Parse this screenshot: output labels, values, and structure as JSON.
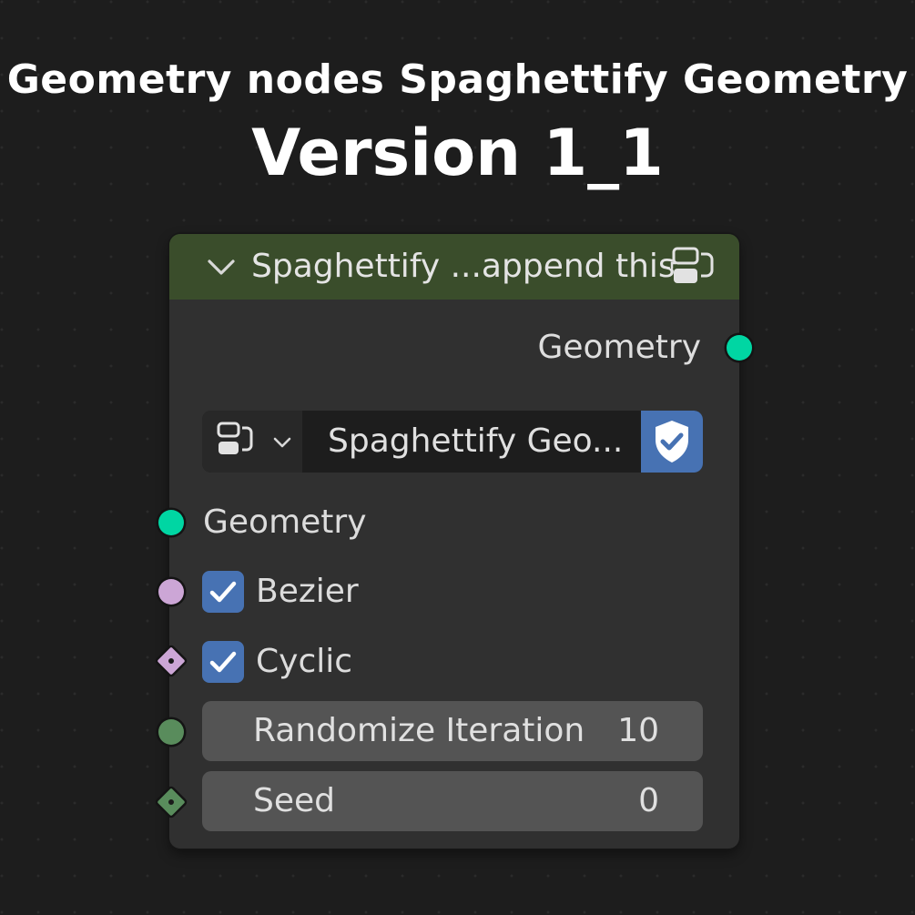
{
  "banner": {
    "title": "Geometry nodes Spaghettify Geometry",
    "version": "Version 1_1"
  },
  "node": {
    "header": {
      "title": "Spaghettify ...append this",
      "color": "#3a4d2b"
    },
    "output": {
      "label": "Geometry",
      "socket_color": "#00d6a3"
    },
    "group_selector": {
      "name": "Spaghettify Geo...",
      "fake_user_color": "#4772b3"
    },
    "inputs": {
      "geometry": {
        "label": "Geometry",
        "socket_color": "#00d6a3"
      },
      "bezier": {
        "label": "Bezier",
        "checked": true,
        "socket_color": "#cca6d6"
      },
      "cyclic": {
        "label": "Cyclic",
        "checked": true,
        "socket_color": "#cca6d6"
      },
      "randomize_iteration": {
        "label": "Randomize Iteration",
        "value": "10",
        "socket_color": "#598c5c"
      },
      "seed": {
        "label": "Seed",
        "value": "0",
        "socket_color": "#598c5c"
      }
    }
  },
  "icons": {
    "collapse": "chevron-down-icon",
    "node_group": "node-group-icon",
    "fake_user": "shield-check-icon",
    "checkbox": "checkmark-icon"
  }
}
